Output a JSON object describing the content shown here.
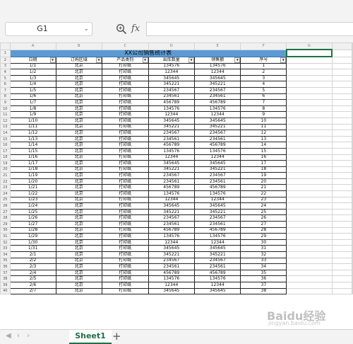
{
  "toolbar": {
    "name_box": "G1",
    "name_box_arrow": "⌄",
    "fx_label": "fx",
    "formula_value": ""
  },
  "grid": {
    "column_letters": [
      "A",
      "B",
      "C",
      "D",
      "E",
      "F",
      "G"
    ],
    "title": "XX公司销售统计表",
    "headers": [
      "日期",
      "订购区域",
      "产品类别",
      "出库数量",
      "销售额",
      "序号"
    ],
    "rows": [
      [
        "1/1",
        "北京",
        "打印纸",
        "134576",
        "134576",
        "1"
      ],
      [
        "1/2",
        "北京",
        "打印纸",
        "12344",
        "12344",
        "2"
      ],
      [
        "1/3",
        "北京",
        "打印纸",
        "345645",
        "345645",
        "3"
      ],
      [
        "1/4",
        "北京",
        "打印纸",
        "345221",
        "345221",
        "4"
      ],
      [
        "1/5",
        "北京",
        "打印纸",
        "234567",
        "234567",
        "5"
      ],
      [
        "1/6",
        "北京",
        "打印纸",
        "234561",
        "234561",
        "6"
      ],
      [
        "1/7",
        "北京",
        "打印纸",
        "456789",
        "456789",
        "7"
      ],
      [
        "1/8",
        "北京",
        "打印纸",
        "134576",
        "134576",
        "8"
      ],
      [
        "1/9",
        "北京",
        "打印纸",
        "12344",
        "12344",
        "9"
      ],
      [
        "1/10",
        "北京",
        "打印纸",
        "345645",
        "345645",
        "10"
      ],
      [
        "1/11",
        "北京",
        "打印纸",
        "345221",
        "345221",
        "11"
      ],
      [
        "1/12",
        "北京",
        "打印纸",
        "234567",
        "234567",
        "12"
      ],
      [
        "1/13",
        "北京",
        "打印纸",
        "234561",
        "234561",
        "13"
      ],
      [
        "1/14",
        "北京",
        "打印纸",
        "456789",
        "456789",
        "14"
      ],
      [
        "1/15",
        "北京",
        "打印纸",
        "134576",
        "134576",
        "15"
      ],
      [
        "1/16",
        "北京",
        "打印纸",
        "12344",
        "12344",
        "16"
      ],
      [
        "1/17",
        "北京",
        "打印纸",
        "345645",
        "345645",
        "17"
      ],
      [
        "1/18",
        "北京",
        "打印纸",
        "345221",
        "345221",
        "18"
      ],
      [
        "1/19",
        "北京",
        "打印纸",
        "234567",
        "234567",
        "19"
      ],
      [
        "1/20",
        "北京",
        "打印纸",
        "234561",
        "234561",
        "20"
      ],
      [
        "1/21",
        "北京",
        "打印纸",
        "456789",
        "456789",
        "21"
      ],
      [
        "1/22",
        "北京",
        "打印纸",
        "134576",
        "134576",
        "22"
      ],
      [
        "1/23",
        "北京",
        "打印纸",
        "12344",
        "12344",
        "23"
      ],
      [
        "1/24",
        "北京",
        "打印纸",
        "345645",
        "345645",
        "24"
      ],
      [
        "1/25",
        "北京",
        "打印纸",
        "345221",
        "345221",
        "25"
      ],
      [
        "1/26",
        "北京",
        "打印纸",
        "234567",
        "234567",
        "26"
      ],
      [
        "1/27",
        "北京",
        "打印纸",
        "234561",
        "234561",
        "27"
      ],
      [
        "1/28",
        "北京",
        "打印纸",
        "456789",
        "456789",
        "28"
      ],
      [
        "1/29",
        "北京",
        "打印纸",
        "134576",
        "134576",
        "29"
      ],
      [
        "1/30",
        "北京",
        "打印纸",
        "12344",
        "12344",
        "30"
      ],
      [
        "1/31",
        "北京",
        "打印纸",
        "345645",
        "345645",
        "31"
      ],
      [
        "2/1",
        "北京",
        "打印纸",
        "345221",
        "345221",
        "32"
      ],
      [
        "2/2",
        "北京",
        "打印纸",
        "234567",
        "234567",
        "33"
      ],
      [
        "2/3",
        "北京",
        "打印纸",
        "234561",
        "234561",
        "34"
      ],
      [
        "2/4",
        "北京",
        "打印纸",
        "456789",
        "456789",
        "35"
      ],
      [
        "2/5",
        "北京",
        "打印纸",
        "134576",
        "134576",
        "36"
      ],
      [
        "2/6",
        "北京",
        "打印纸",
        "12344",
        "12344",
        "37"
      ],
      [
        "2/7",
        "北京",
        "打印纸",
        "345645",
        "345645",
        "38"
      ]
    ]
  },
  "sheets": {
    "tabs": [
      {
        "label": "Sheet1",
        "active": true
      }
    ],
    "add_label": "+",
    "nav_first": "◀",
    "nav_prev": "‹",
    "nav_next": "›"
  },
  "watermark": {
    "brand": "Baidu经验",
    "url": "jingyan.baidu.com"
  },
  "colors": {
    "title_fill": "#5b9bd5",
    "selection": "#1e7145",
    "active_tab": "#1e7145"
  },
  "icons": {
    "zoom": "zoom-icon",
    "filter": "filter-dropdown-icon"
  }
}
